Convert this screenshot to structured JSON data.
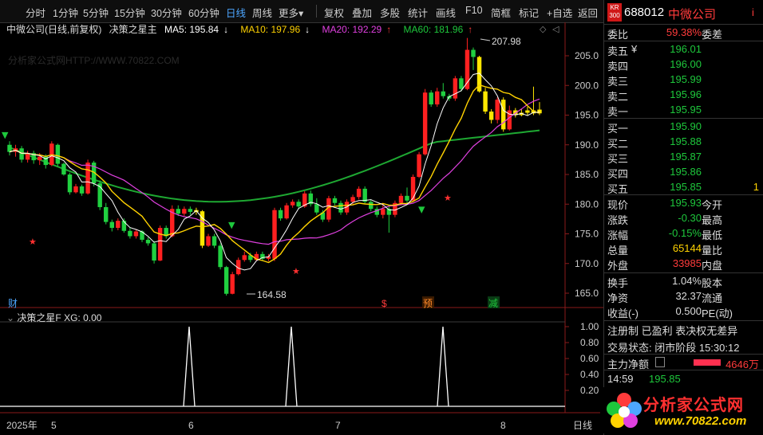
{
  "toolbar": {
    "periods": [
      "分时",
      "1分钟",
      "5分钟",
      "15分钟",
      "30分钟",
      "60分钟",
      "日线",
      "周线",
      "更多"
    ],
    "more_arrow": "▾",
    "tools": [
      "复权",
      "叠加",
      "多股",
      "统计",
      "画线",
      "F10",
      "简框",
      "标记",
      "+自选",
      "返回"
    ]
  },
  "legend": {
    "title": "中微公司(日线,前复权)",
    "indicator": "决策之星主",
    "ma5": "MA5: 195.84",
    "ma5_arrow": "↓",
    "ma10": "MA10: 197.96",
    "ma10_arrow": "↓",
    "ma20": "MA20: 192.29",
    "ma20_arrow": "↑",
    "ma60": "MA60: 181.96",
    "ma60_arrow": "↑"
  },
  "watermark": "分析家公式网HTTP://WWW.70822.COM",
  "price_axis": [
    "205.0",
    "200.0",
    "195.0",
    "190.0",
    "185.0",
    "180.0",
    "175.0",
    "170.0",
    "165.0"
  ],
  "annotations": {
    "high": "207.98",
    "low": "164.58"
  },
  "event_markers": [
    {
      "text": "财",
      "color": "#4da6ff"
    },
    {
      "text": "$",
      "color": "#ff3b3b"
    },
    {
      "text": "预",
      "color": "#ff8a2a"
    },
    {
      "text": "减",
      "color": "#1ec83c"
    }
  ],
  "indicator": {
    "name": "决策之星F",
    "xg": "XG: 0.00",
    "axis": [
      "1.00",
      "0.80",
      "0.60",
      "0.40",
      "0.20"
    ]
  },
  "date_axis": {
    "year": "2025年",
    "months": [
      "5",
      "6",
      "7",
      "8"
    ],
    "period_label": "日线"
  },
  "quote": {
    "badge": "KR\n300",
    "code": "688012",
    "name": "中微公司",
    "info_icon": "i",
    "weibi_label": "委比",
    "weibi_value": "59.38%",
    "weicha_label": "委差",
    "asks": [
      {
        "label": "卖五",
        "unit": "¥",
        "price": "196.01",
        "vol": ""
      },
      {
        "label": "卖四",
        "unit": "",
        "price": "196.00",
        "vol": ""
      },
      {
        "label": "卖三",
        "unit": "",
        "price": "195.99",
        "vol": ""
      },
      {
        "label": "卖二",
        "unit": "",
        "price": "195.96",
        "vol": ""
      },
      {
        "label": "卖一",
        "unit": "",
        "price": "195.95",
        "vol": ""
      }
    ],
    "bids": [
      {
        "label": "买一",
        "price": "195.90",
        "vol": ""
      },
      {
        "label": "买二",
        "price": "195.88",
        "vol": ""
      },
      {
        "label": "买三",
        "price": "195.87",
        "vol": ""
      },
      {
        "label": "买四",
        "price": "195.86",
        "vol": ""
      },
      {
        "label": "买五",
        "price": "195.85",
        "vol": "1"
      }
    ],
    "stats": [
      {
        "l": "现价",
        "v": "195.93",
        "vc": "green",
        "l2": "今开",
        "v2": ""
      },
      {
        "l": "涨跌",
        "v": "-0.30",
        "vc": "green",
        "l2": "最高",
        "v2": ""
      },
      {
        "l": "涨幅",
        "v": "-0.15%",
        "vc": "green",
        "l2": "最低",
        "v2": ""
      },
      {
        "l": "总量",
        "v": "65144",
        "vc": "yellow",
        "l2": "量比",
        "v2": ""
      },
      {
        "l": "外盘",
        "v": "33985",
        "vc": "red",
        "l2": "内盘",
        "v2": ""
      }
    ],
    "stats2": [
      {
        "l": "换手",
        "v": "1.04%",
        "l2": "股本"
      },
      {
        "l": "净资",
        "v": "32.37",
        "l2": "流通"
      },
      {
        "l": "收益(-)",
        "v": "0.500",
        "l2": "PE(动)"
      }
    ],
    "reg": "注册制 已盈利 表决权无差异",
    "trade_status": "交易状态: 闭市阶段 15:30:12",
    "main_net_label": "主力净额",
    "main_net_value": "4646万",
    "tick_time": "14:59",
    "tick_price": "195.85"
  },
  "logo": {
    "text": "分析家公式网",
    "url": "www.70822.com"
  },
  "colors": {
    "up": "#ff2020",
    "down": "#20d040",
    "ma5": "#ffffff",
    "ma10": "#ffd200",
    "ma20": "#e040e0",
    "ma60": "#1ea832"
  }
}
